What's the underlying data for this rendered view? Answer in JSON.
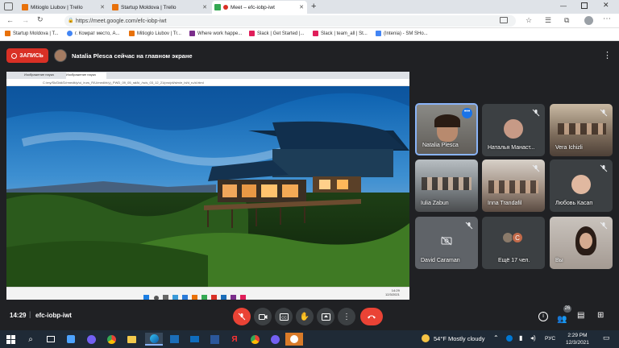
{
  "browser": {
    "tabs": [
      {
        "label": "Mitioglo Liubov | Trello",
        "color": "#e8710a"
      },
      {
        "label": "Startup Moldova | Trello",
        "color": "#e8710a"
      },
      {
        "label": "Meet – efc-iobp-iwt",
        "color": "#34a853"
      }
    ],
    "url": "https://meet.google.com/efc-iobp-iwt",
    "bookmarks": [
      {
        "label": "Startup Moldova | T...",
        "color": "#e8710a"
      },
      {
        "label": "г. Комрат место, А...",
        "color": "#4285f4"
      },
      {
        "label": "Mitioglo Liubov | Tr...",
        "color": "#e8710a"
      },
      {
        "label": "Where work happe...",
        "color": "#7b2d8b"
      },
      {
        "label": "Slack | Get Started |...",
        "color": "#e01e5a"
      },
      {
        "label": "Slack | team_all | St...",
        "color": "#e01e5a"
      },
      {
        "label": "(Intenia) - SM SHo...",
        "color": "#4285f4"
      }
    ]
  },
  "meet": {
    "record_label": "ЗАПИСЬ",
    "presenter_banner": "Natalia Plesca сейчас на главном экране",
    "shared_screen": {
      "tab1": "Изображение наука",
      "tab2": "Изображение наука",
      "url": "C:/my/Sk/Didi/D/rmedit/y/ui_/rurs_R/U/medi/ri/y)_PWD_09_05_ral/ki_/ru/s_03_12_21/pro/ptl/slm/e_bl/d_ru/d.html",
      "clock_time": "14:29",
      "clock_date": "12/3/2021"
    },
    "participants": [
      {
        "name": "Natalia Plesca",
        "kind": "video",
        "active": true,
        "mic_off": false
      },
      {
        "name": "Наталья Манаст...",
        "kind": "avatar",
        "mic_off": true,
        "avatar_color": "#c79a86"
      },
      {
        "name": "Vera Ichizli",
        "kind": "video",
        "mic_off": true
      },
      {
        "name": "Iulia Zabun",
        "kind": "video",
        "mic_off": false
      },
      {
        "name": "Inna Trandafil",
        "kind": "video",
        "mic_off": true
      },
      {
        "name": "Любовь Касап",
        "kind": "avatar",
        "mic_off": true,
        "avatar_color": "#e0b8a0"
      },
      {
        "name": "David Caraman",
        "kind": "camera-off",
        "mic_off": true
      },
      {
        "name": "Ещё 17 чел.",
        "kind": "more",
        "initial": "C"
      },
      {
        "name": "Вы",
        "kind": "video",
        "mic_off": true
      }
    ],
    "time": "14:29",
    "meeting_code": "efc-iobp-iwt",
    "participants_count": "26"
  },
  "taskbar": {
    "weather": "54°F  Mostly cloudy",
    "lang": "РУС",
    "time": "2:29 PM",
    "date": "12/3/2021"
  }
}
